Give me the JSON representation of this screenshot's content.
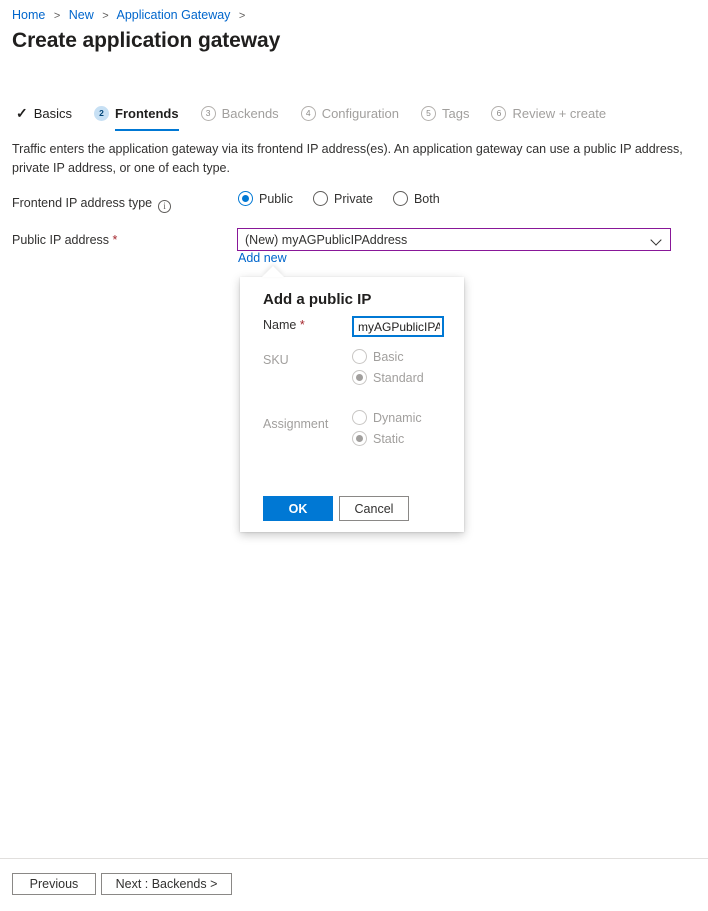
{
  "breadcrumb": {
    "items": [
      {
        "label": "Home"
      },
      {
        "label": "New"
      },
      {
        "label": "Application Gateway"
      }
    ],
    "separator": ">"
  },
  "page": {
    "title": "Create application gateway"
  },
  "tabs": [
    {
      "label": "Basics",
      "badge": "✓",
      "state": "done"
    },
    {
      "label": "Frontends",
      "badge": "2",
      "state": "active"
    },
    {
      "label": "Backends",
      "badge": "3",
      "state": "pending"
    },
    {
      "label": "Configuration",
      "badge": "4",
      "state": "pending"
    },
    {
      "label": "Tags",
      "badge": "5",
      "state": "pending"
    },
    {
      "label": "Review + create",
      "badge": "6",
      "state": "pending"
    }
  ],
  "main": {
    "description": "Traffic enters the application gateway via its frontend IP address(es). An application gateway can use a public IP address, private IP address, or one of each type.",
    "frontend_ip_type": {
      "label": "Frontend IP address type",
      "info_glyph": "i",
      "options": [
        {
          "label": "Public",
          "selected": true
        },
        {
          "label": "Private",
          "selected": false
        },
        {
          "label": "Both",
          "selected": false
        }
      ]
    },
    "public_ip": {
      "label": "Public IP address",
      "required_marker": "*",
      "selected_value": "(New) myAGPublicIPAddress",
      "add_new_link": "Add new"
    }
  },
  "popup": {
    "title": "Add a public IP",
    "name": {
      "label": "Name",
      "required_marker": "*",
      "value": "myAGPublicIPAddress",
      "placeholder": "Name"
    },
    "sku": {
      "label": "SKU",
      "options": [
        {
          "label": "Basic",
          "selected": false
        },
        {
          "label": "Standard",
          "selected": true
        }
      ]
    },
    "assignment": {
      "label": "Assignment",
      "options": [
        {
          "label": "Dynamic",
          "selected": false
        },
        {
          "label": "Static",
          "selected": true
        }
      ]
    },
    "ok_label": "OK",
    "cancel_label": "Cancel"
  },
  "footer": {
    "previous_label": "Previous",
    "next_label": "Next : Backends >"
  },
  "colors": {
    "accent": "#0078d4",
    "link": "#0066cc",
    "required": "#a4262c",
    "dropdown_border": "#881798",
    "tab_active_badge": "#c7e0f4"
  }
}
